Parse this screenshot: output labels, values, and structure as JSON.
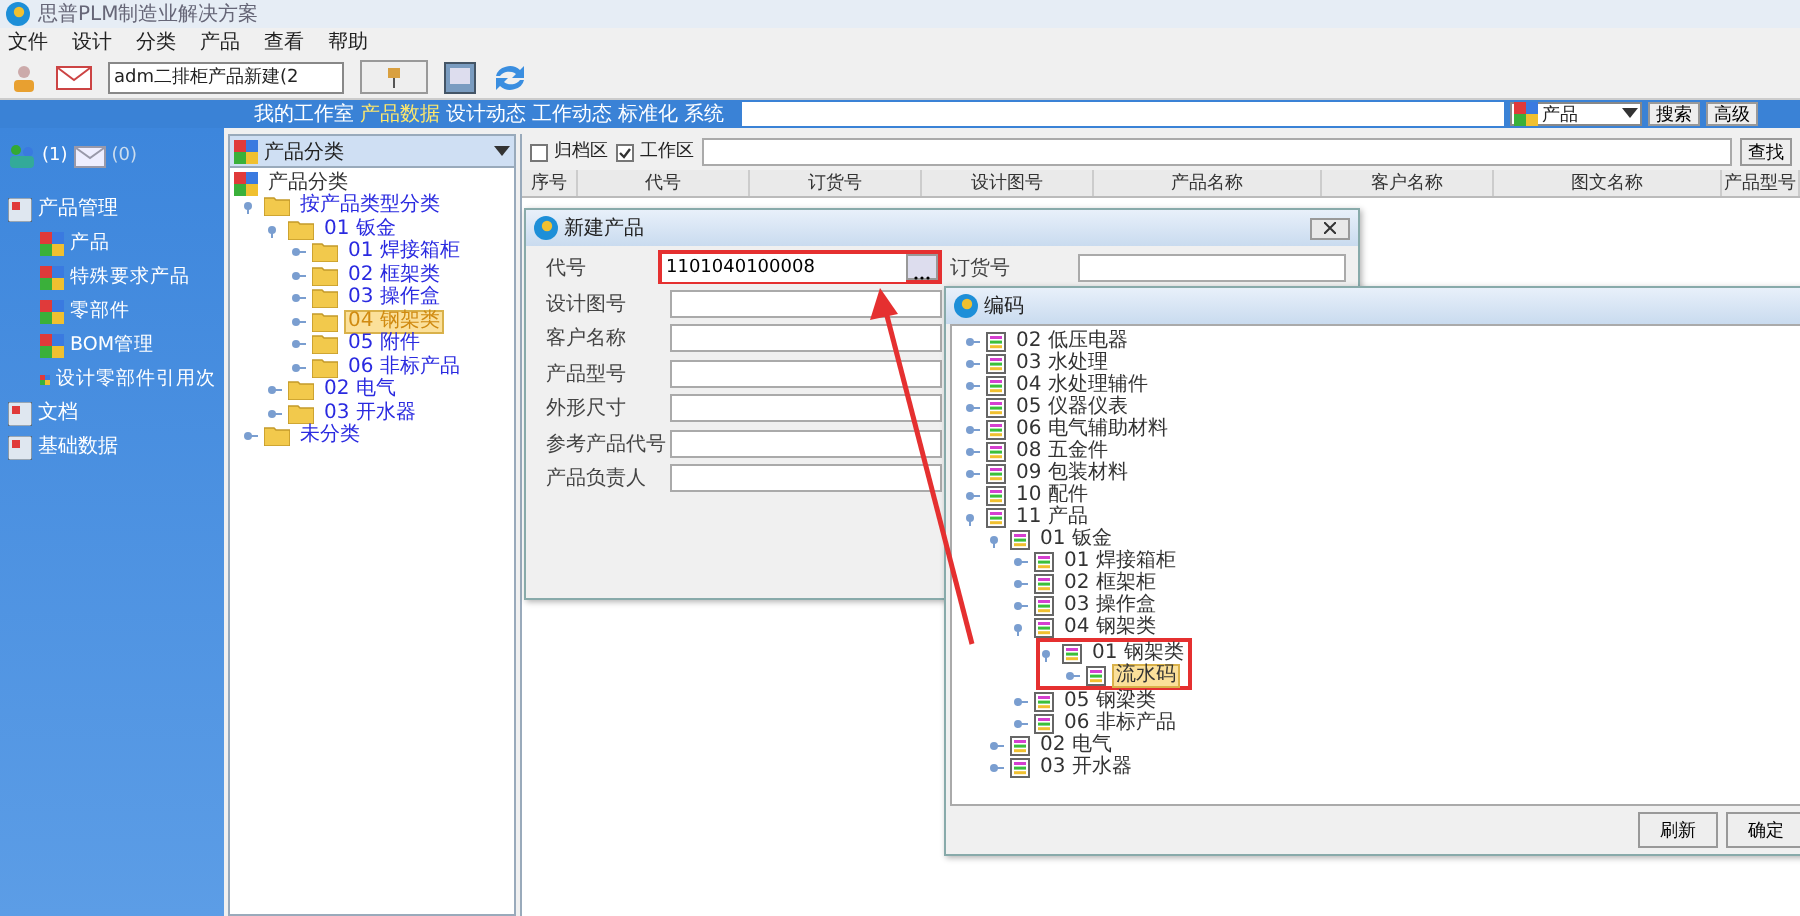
{
  "window": {
    "title": "思普PLM制造业解决方案"
  },
  "menu": [
    "文件",
    "设计",
    "分类",
    "产品",
    "查看",
    "帮助"
  ],
  "toolbar": {
    "recent_value": "adm二排柜产品新建(2"
  },
  "nav": [
    {
      "label": "我的工作室",
      "selected": false
    },
    {
      "label": "产品数据",
      "selected": true
    },
    {
      "label": "设计动态",
      "selected": false
    },
    {
      "label": "工作动态",
      "selected": false
    },
    {
      "label": "标准化",
      "selected": false
    },
    {
      "label": "系统",
      "selected": false
    }
  ],
  "search": {
    "scope": "产品",
    "buttons": [
      "搜索",
      "高级"
    ]
  },
  "sidebar": {
    "counts": [
      "(1)",
      "(0)"
    ],
    "sections": [
      {
        "label": "产品管理",
        "items": [
          "产品",
          "特殊要求产品",
          "零部件",
          "BOM管理",
          "设计零部件引用次"
        ]
      },
      {
        "label": "文档"
      },
      {
        "label": "基础数据"
      }
    ]
  },
  "category_panel": {
    "selector": "产品分类",
    "tree": [
      {
        "label": "产品分类",
        "children": [
          {
            "label": "按产品类型分类",
            "expanded": true,
            "children": [
              {
                "label": "01 钣金",
                "expanded": true,
                "children": [
                  {
                    "label": "01 焊接箱柜",
                    "selected": false
                  },
                  {
                    "label": "02 框架类",
                    "selected": false
                  },
                  {
                    "label": "03 操作盒",
                    "selected": false
                  },
                  {
                    "label": "04 钢架类",
                    "selected": true
                  },
                  {
                    "label": "05 附件",
                    "selected": false
                  },
                  {
                    "label": "06 非标产品",
                    "selected": false
                  }
                ]
              },
              {
                "label": "02 电气",
                "selected": false
              },
              {
                "label": "03 开水器",
                "selected": false
              }
            ]
          },
          {
            "label": "未分类",
            "selected": false
          }
        ]
      }
    ]
  },
  "filters": [
    {
      "label": "归档区",
      "checked": false
    },
    {
      "label": "工作区",
      "checked": true
    }
  ],
  "find_button": "查找",
  "table": {
    "columns": [
      "序号",
      "代号",
      "订货号",
      "设计图号",
      "产品名称",
      "客户名称",
      "图文名称",
      "产品型号"
    ]
  },
  "new_product_dialog": {
    "title": "新建产品",
    "fields": [
      {
        "label": "代号",
        "value": "1101040100008",
        "highlighted": true
      },
      {
        "label": "设计图号"
      },
      {
        "label": "客户名称"
      },
      {
        "label": "产品型号"
      },
      {
        "label": "外形尺寸"
      },
      {
        "label": "参考产品代号"
      },
      {
        "label": "产品负责人"
      }
    ],
    "side_field": {
      "label": "订货号"
    }
  },
  "code_dialog": {
    "title": "编码",
    "tree": [
      {
        "label": "02 低压电器"
      },
      {
        "label": "03 水处理"
      },
      {
        "label": "04 水处理辅件"
      },
      {
        "label": "05 仪器仪表"
      },
      {
        "label": "06 电气辅助材料"
      },
      {
        "label": "08 五金件"
      },
      {
        "label": "09 包装材料"
      },
      {
        "label": "10 配件"
      },
      {
        "label": "11 产品",
        "expanded": true,
        "children": [
          {
            "label": "01 钣金",
            "expanded": true,
            "children": [
              {
                "label": "01 焊接箱柜"
              },
              {
                "label": "02 框架柜"
              },
              {
                "label": "03 操作盒"
              },
              {
                "label": "04 钢架类",
                "expanded": true,
                "children": [
                  {
                    "label": "01 钢架类",
                    "expanded": true,
                    "highlighted": true,
                    "children": [
                      {
                        "label": "流水码",
                        "selected": true
                      }
                    ]
                  }
                ]
              },
              {
                "label": "05 钢梁类"
              },
              {
                "label": "06 非标产品"
              }
            ]
          },
          {
            "label": "02 电气"
          },
          {
            "label": "03 开水器"
          }
        ]
      }
    ],
    "buttons": [
      "刷新",
      "确定"
    ]
  }
}
